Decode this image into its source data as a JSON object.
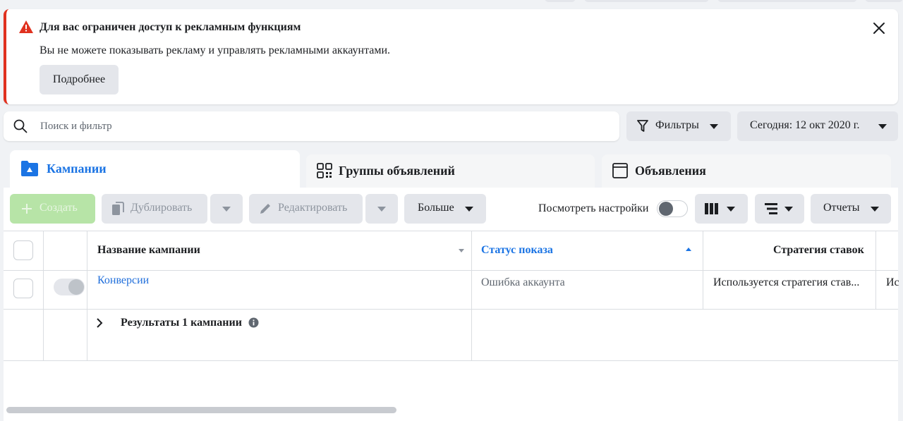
{
  "alert": {
    "title": "Для вас ограничен доступ к рекламным функциям",
    "message": "Вы не можете показывать рекламу и управлять рекламными аккаунтами.",
    "learn_more_label": "Подробнее"
  },
  "search": {
    "placeholder": "Поиск и фильтр"
  },
  "filters_label": "Фильтры",
  "date_label": "Сегодня: 12 окт 2020 г.",
  "tabs": [
    {
      "label": "Кампании"
    },
    {
      "label": "Группы объявлений"
    },
    {
      "label": "Объявления"
    }
  ],
  "toolbar": {
    "create_label": "Создать",
    "duplicate_label": "Дублировать",
    "edit_label": "Редактировать",
    "more_label": "Больше",
    "view_settings_label": "Посмотреть настройки",
    "reports_label": "Отчеты"
  },
  "table": {
    "columns": {
      "name": "Название кампании",
      "status": "Статус показа",
      "strategy": "Стратегия ставок",
      "next": "Ис"
    },
    "rows": [
      {
        "name": "Конверсии",
        "status": "Ошибка аккаунта",
        "strategy": "Используется стратегия став..."
      }
    ],
    "results_label": "Результаты 1 кампании"
  },
  "colors": {
    "accent": "#1b74e4",
    "link": "#216fdb",
    "error": "#e0311f",
    "create_green": "#b7e4a7"
  }
}
